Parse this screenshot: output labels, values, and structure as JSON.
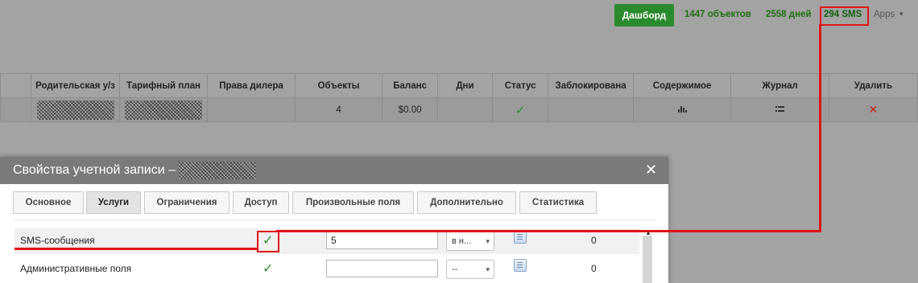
{
  "header": {
    "dashboard_label": "Дашборд",
    "objects_count": "1447 объектов",
    "days_count": "2558 дней",
    "sms_count": "294 SMS",
    "apps_label": "Apps"
  },
  "table": {
    "columns": [
      "Родительская у/з",
      "Тарифный план",
      "Права дилера",
      "Объекты",
      "Баланс",
      "Дни",
      "Статус",
      "Заблокирована",
      "Содержимое",
      "Журнал",
      "Удалить"
    ],
    "row": {
      "objects": "4",
      "balance": "$0.00"
    }
  },
  "modal": {
    "title": "Свойства учетной записи –",
    "tabs": [
      "Основное",
      "Услуги",
      "Ограничения",
      "Доступ",
      "Произвольные поля",
      "Дополнительно",
      "Статистика"
    ],
    "active_tab": "Услуги",
    "services": [
      {
        "label": "SMS-сообщения",
        "enabled": true,
        "value": "5",
        "select": "в н...",
        "count": "0"
      },
      {
        "label": "Административные поля",
        "enabled": true,
        "value": "",
        "select": "--",
        "count": "0"
      }
    ]
  },
  "colors": {
    "dashboard_button": "#2a8a2e",
    "highlight": "#e01414",
    "check": "#2d8a2a",
    "delete": "#c6231a"
  },
  "icons": {
    "status": "checkmark-icon",
    "content": "bar-chart-icon",
    "journal": "list-icon",
    "delete": "cross-icon",
    "close": "close-icon"
  }
}
